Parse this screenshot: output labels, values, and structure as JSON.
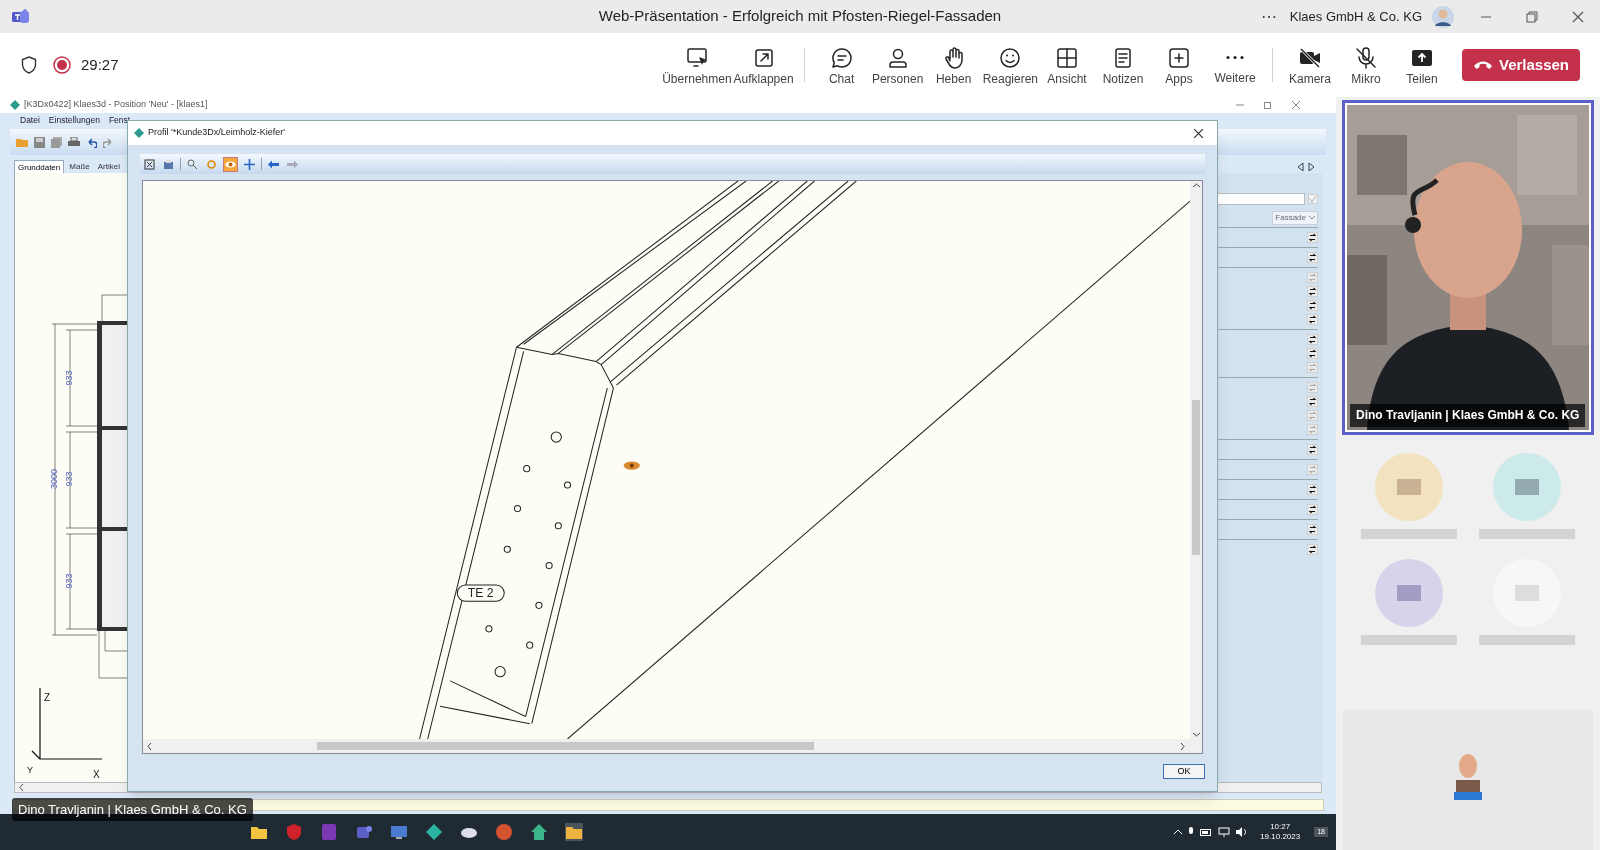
{
  "window": {
    "title": "Web-Präsentation - Erfolgreich mit Pfosten-Riegel-Fassaden",
    "more": "⋯",
    "account": "Klaes GmbH & Co. KG"
  },
  "meeting": {
    "timer": "29:27",
    "recording": true
  },
  "toolbar": [
    {
      "label": "Übernehmen",
      "kind": "take",
      "group_start": false
    },
    {
      "label": "Aufklappen",
      "kind": "popout"
    },
    {
      "label": "Chat",
      "kind": "chat",
      "group_start": true
    },
    {
      "label": "Personen",
      "kind": "people"
    },
    {
      "label": "Heben",
      "kind": "hand"
    },
    {
      "label": "Reagieren",
      "kind": "smile"
    },
    {
      "label": "Ansicht",
      "kind": "view"
    },
    {
      "label": "Notizen",
      "kind": "notes"
    },
    {
      "label": "Apps",
      "kind": "apps"
    },
    {
      "label": "Weitere",
      "kind": "more"
    },
    {
      "label": "Kamera",
      "kind": "camera-off",
      "group_start": true
    },
    {
      "label": "Mikro",
      "kind": "mic-off"
    },
    {
      "label": "Teilen",
      "kind": "share"
    }
  ],
  "leave_button": "Verlassen",
  "shared_screen": {
    "app_title": "[K3Dx0422] Klaes3d - Position 'Neu' - [klaes1]",
    "menu": [
      "Datei",
      "Einstellungen",
      "Fenst"
    ],
    "tabs": [
      {
        "label": "Grunddaten",
        "selected": true
      },
      {
        "label": "Maße",
        "selected": false
      },
      {
        "label": "Artikel",
        "selected": false
      }
    ],
    "dimensions": {
      "total": "3000",
      "parts": [
        "933",
        "933",
        "933"
      ],
      "axes": [
        "Z",
        "Y",
        "X"
      ]
    },
    "dialog": {
      "title": "Profil '*Kunde3Dx/Leimholz-Kiefer'",
      "tools": [
        {
          "kind": "fit",
          "selected": false
        },
        {
          "kind": "print",
          "selected": false
        },
        {
          "kind": "zoom",
          "selected": false
        },
        {
          "kind": "rotate",
          "selected": false
        },
        {
          "kind": "view",
          "selected": true
        },
        {
          "kind": "pan",
          "selected": false
        },
        {
          "kind": "back",
          "selected": false
        },
        {
          "kind": "forward",
          "selected": false
        }
      ],
      "part_label": "TE 2",
      "ok": "OK"
    },
    "side_panel": {
      "dropdown": "Fassade",
      "refresh_groups": [
        [
          {
            "enabled": true
          }
        ],
        [
          {
            "enabled": true
          }
        ],
        [
          {
            "enabled": false
          },
          {
            "enabled": true
          },
          {
            "enabled": true
          },
          {
            "enabled": true
          }
        ],
        [
          {
            "enabled": true
          },
          {
            "enabled": true
          },
          {
            "enabled": false
          }
        ],
        [
          {
            "enabled": false
          },
          {
            "enabled": true
          },
          {
            "enabled": false
          },
          {
            "enabled": false
          }
        ],
        [
          {
            "enabled": true
          }
        ],
        [
          {
            "enabled": false
          }
        ],
        [
          {
            "enabled": true
          }
        ],
        [
          {
            "enabled": true
          }
        ],
        [
          {
            "enabled": true
          }
        ],
        [
          {
            "enabled": true
          }
        ]
      ],
      "checked": true
    },
    "taskbar": {
      "time": "10:27",
      "date": "19.10.2023",
      "notifications": "18"
    },
    "presenter_label": "Dino Travljanin | Klaes GmbH & Co. KG"
  },
  "video": {
    "name": "Dino Travljanin | Klaes GmbH & Co. KG",
    "speaking": true
  }
}
